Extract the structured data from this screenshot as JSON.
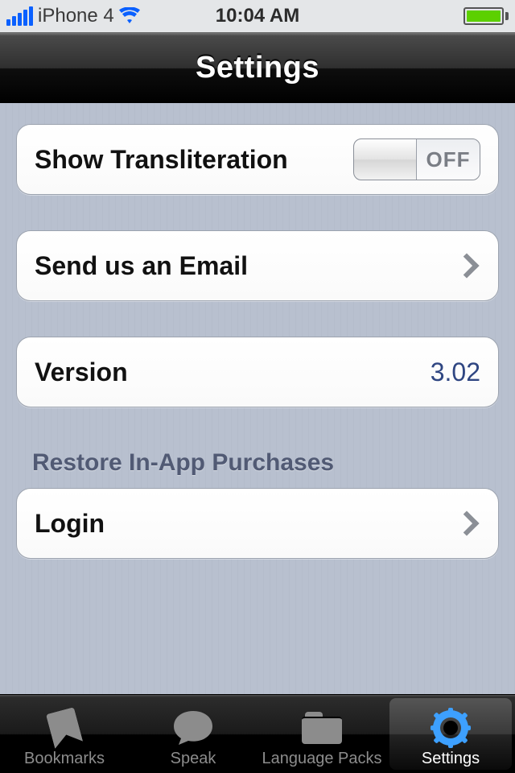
{
  "status": {
    "carrier": "iPhone 4",
    "time": "10:04 AM"
  },
  "nav": {
    "title": "Settings"
  },
  "rows": {
    "transliteration_label": "Show Transliteration",
    "transliteration_toggle_label": "OFF",
    "email_label": "Send us an Email",
    "version_label": "Version",
    "version_value": "3.02",
    "login_label": "Login"
  },
  "sections": {
    "restore_header": "Restore In-App Purchases"
  },
  "tabs": {
    "bookmarks": "Bookmarks",
    "speak": "Speak",
    "language_packs": "Language Packs",
    "settings": "Settings"
  }
}
